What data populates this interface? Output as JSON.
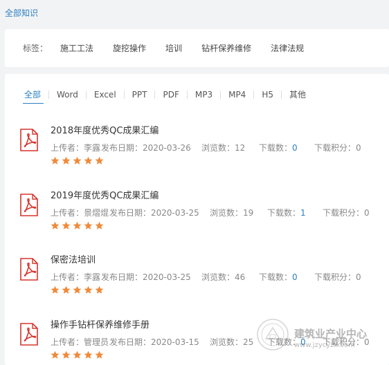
{
  "breadcrumb": "全部知识",
  "tags": {
    "label": "标签：",
    "items": [
      "施工工法",
      "旋挖操作",
      "培训",
      "钻杆保养维修",
      "法律法规"
    ]
  },
  "filters": [
    "全部",
    "Word",
    "Excel",
    "PPT",
    "PDF",
    "MP3",
    "MP4",
    "H5",
    "其他"
  ],
  "documents": [
    {
      "title": "2018年度优秀QC成果汇编",
      "uploader": "上传者：李露",
      "date": "发布日期：2020-03-26",
      "views": "浏览数：12",
      "downloads_label": "下载数：",
      "downloads": "0",
      "points": "下载积分：0",
      "rating": 5
    },
    {
      "title": "2019年度优秀QC成果汇编",
      "uploader": "上传者：景熠焜",
      "date": "发布日期：2020-03-25",
      "views": "浏览数：19",
      "downloads_label": "下载数：",
      "downloads": "1",
      "points": "下载积分：0",
      "rating": 5
    },
    {
      "title": "保密法培训",
      "uploader": "上传者：李露",
      "date": "发布日期：2020-03-25",
      "views": "浏览数：46",
      "downloads_label": "下载数：",
      "downloads": "0",
      "points": "下载积分：0",
      "rating": 5
    },
    {
      "title": "操作手钻杆保养维修手册",
      "uploader": "上传者：管理员",
      "date": "发布日期：2020-03-15",
      "views": "浏览数：25",
      "downloads_label": "下载数：",
      "downloads": "0",
      "points": "下载积分：0",
      "rating": 5
    }
  ],
  "watermark": {
    "title": "建筑业产业中心",
    "url": "www.jzycyzx.com"
  },
  "colors": {
    "accent": "#2a7fc1",
    "pdf_red": "#d9322c",
    "star": "#f08a3a"
  }
}
